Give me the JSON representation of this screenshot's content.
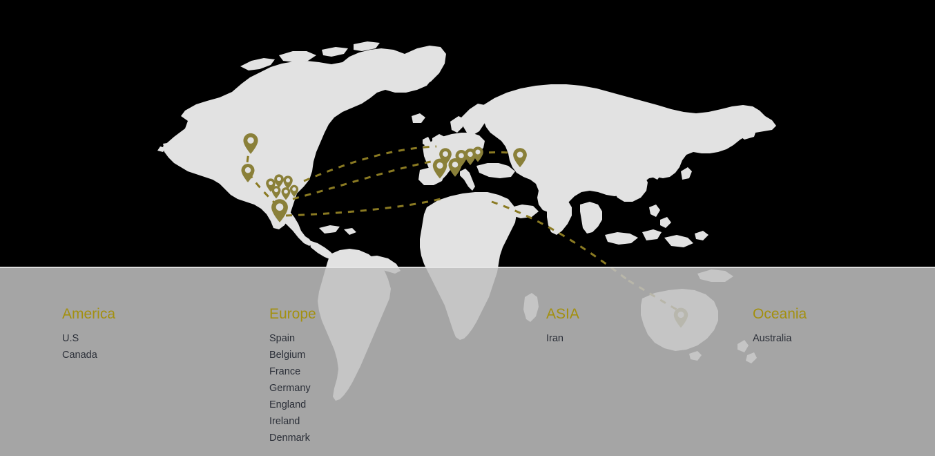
{
  "colors": {
    "background": "#000000",
    "land": "#e2e2e2",
    "pin": "#8a8039",
    "route": "#8a7a22",
    "panel": "#c0c0c0",
    "panel_divider": "#f0f0f0",
    "heading": "#a3900f",
    "body_text": "#2b2f38"
  },
  "map": {
    "title": "world-map",
    "pin_icon": "map-pin-icon",
    "route_style": "dashed"
  },
  "legend": {
    "columns": [
      {
        "id": "america",
        "title": "America",
        "items": [
          "U.S",
          "Canada"
        ]
      },
      {
        "id": "europe",
        "title": "Europe",
        "items": [
          "Spain",
          "Belgium",
          "France",
          "Germany",
          "England",
          "Ireland",
          "Denmark"
        ]
      },
      {
        "id": "asia",
        "title": "ASIA",
        "items": [
          "Iran"
        ]
      },
      {
        "id": "oceania",
        "title": "Oceania",
        "items": [
          "Australia"
        ]
      }
    ]
  }
}
